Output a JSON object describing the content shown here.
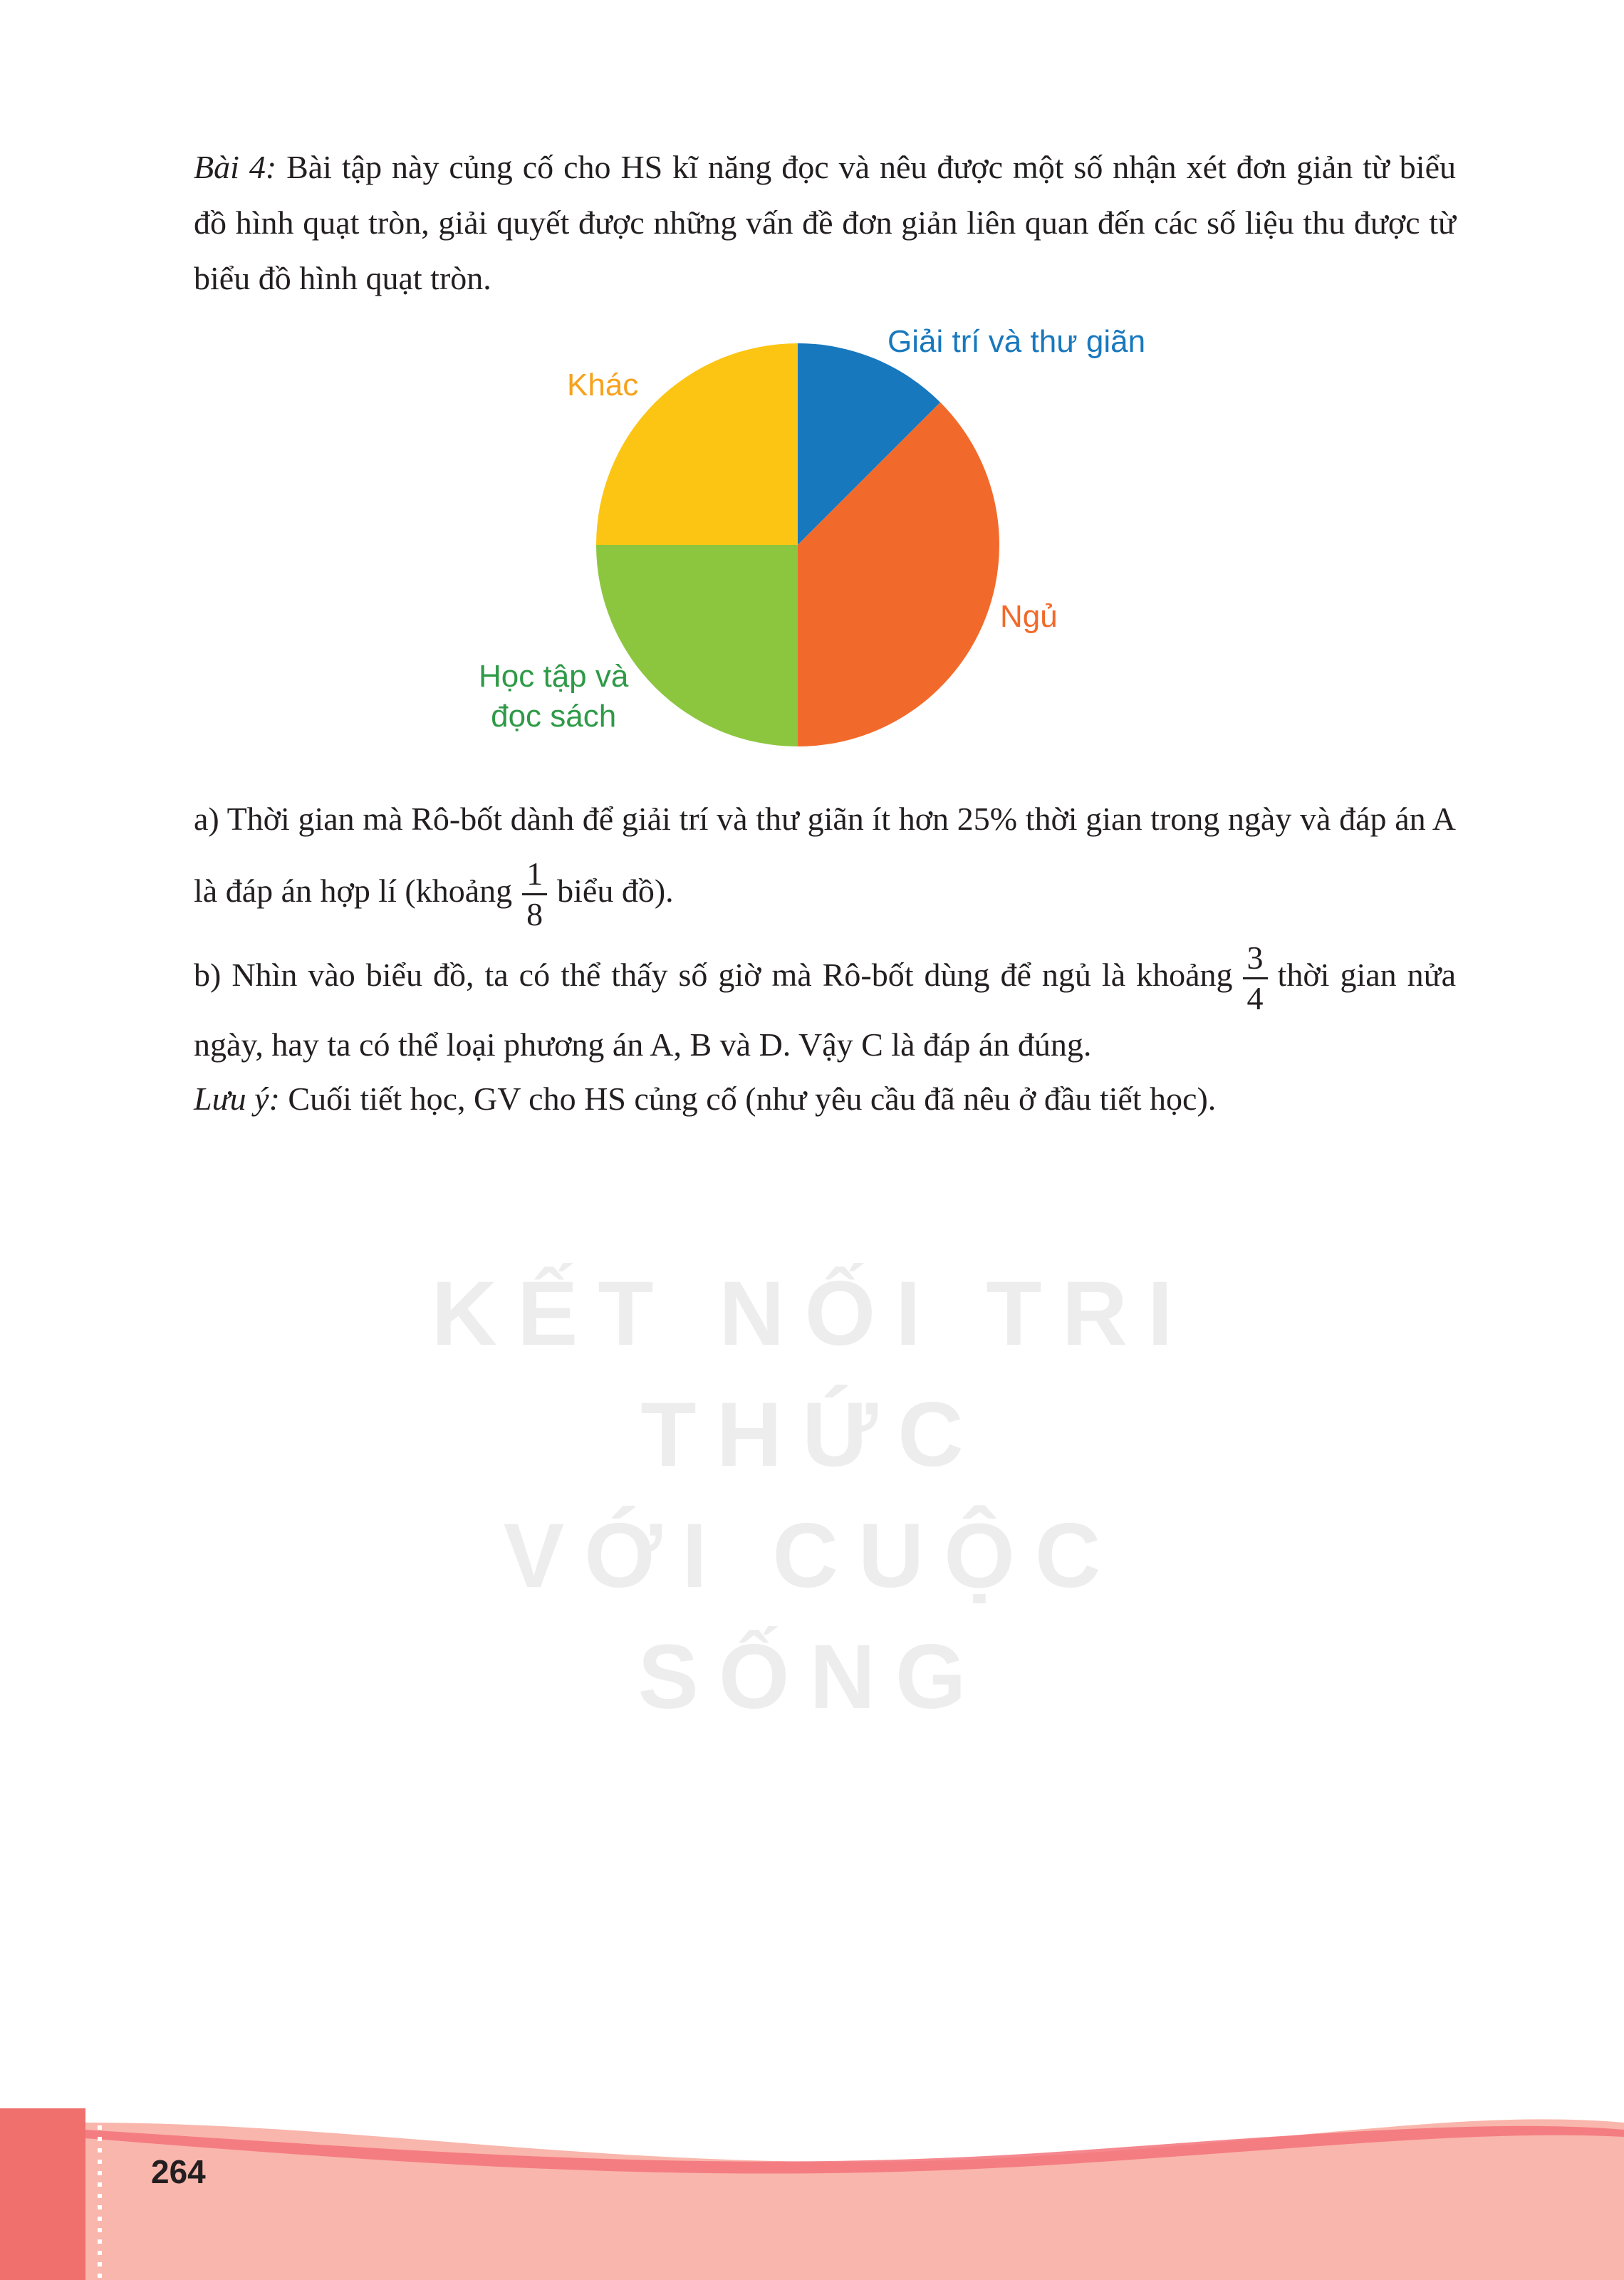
{
  "exercise": {
    "label": "Bài 4:",
    "intro": " Bài tập này củng cố cho HS kĩ năng đọc và nêu được một số nhận xét đơn giản từ biểu đồ hình quạt tròn, giải quyết được những vấn đề đơn giản liên quan đến các số liệu thu được từ biểu đồ hình quạt tròn."
  },
  "chart_data": {
    "type": "pie",
    "categories": [
      "Giải trí và thư giãn",
      "Ngủ",
      "Học tập và đọc sách",
      "Khác"
    ],
    "values": [
      12.5,
      37.5,
      25,
      25
    ],
    "colors": [
      "#1878be",
      "#f26a2b",
      "#8cc63f",
      "#fcc514"
    ],
    "label_lines": {
      "entertainment": "Giải trí và thư giãn",
      "sleep": "Ngủ",
      "study_line1": "Học tập và",
      "study_line2": "đọc sách",
      "other": "Khác"
    }
  },
  "answers": {
    "a_text": "a) Thời gian mà Rô-bốt dành để giải trí và thư giãn ít hơn 25% thời gian trong ngày và đáp án A là đáp án hợp lí (khoảng",
    "a_frac_num": "1",
    "a_frac_den": "8",
    "a_text_end": "biểu đồ).",
    "b_text": "b) Nhìn vào biểu đồ, ta có thể thấy số giờ mà Rô-bốt dùng để ngủ là khoảng",
    "b_frac_num": "3",
    "b_frac_den": "4",
    "b_text_end": "thời gian nửa ngày, hay ta có thể loại phương án A, B và D. Vậy C là đáp án đúng."
  },
  "note": {
    "label": "Lưu ý:",
    "text": " Cuối tiết học, GV cho HS củng cố (như yêu cầu đã nêu ở đầu tiết học)."
  },
  "watermark": {
    "line1": "KẾT NỐI TRI THỨC",
    "line2": "VỚI CUỘC SỐNG"
  },
  "footer": {
    "page_number": "264"
  }
}
